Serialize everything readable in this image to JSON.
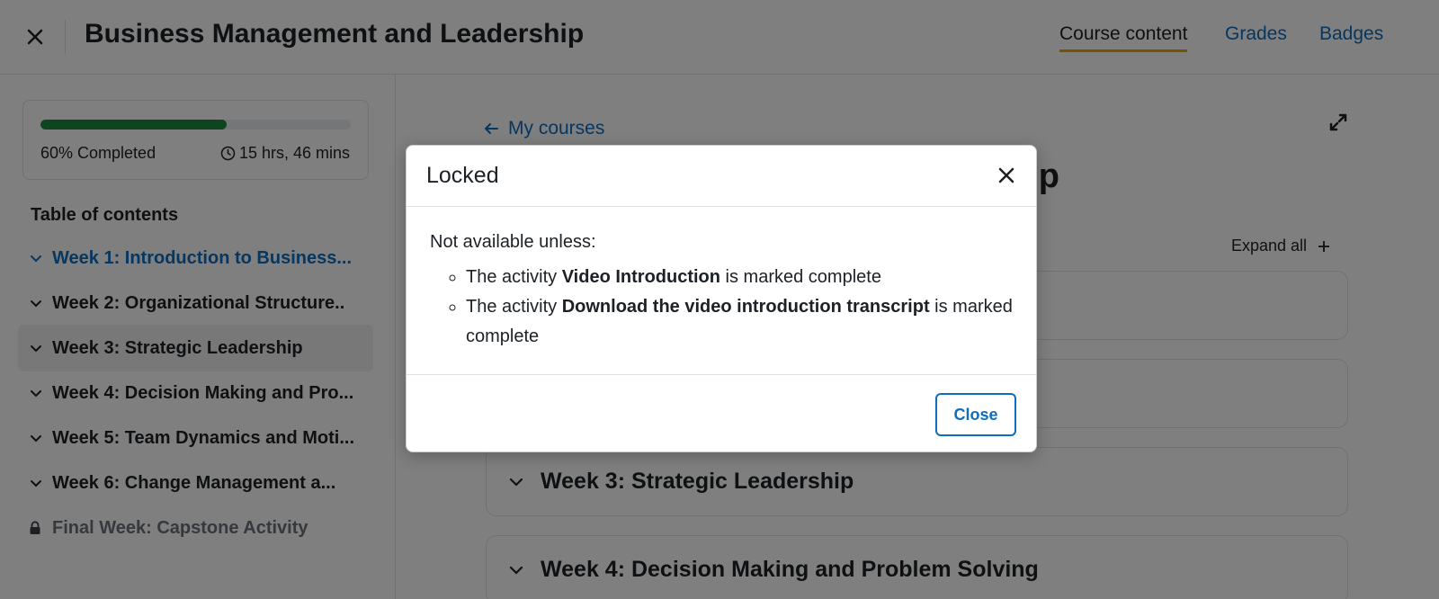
{
  "header": {
    "title": "Business Management and Leadership",
    "nav": [
      {
        "label": "Course content",
        "active": true
      },
      {
        "label": "Grades",
        "active": false
      },
      {
        "label": "Badges",
        "active": false
      }
    ]
  },
  "sidebar": {
    "progress": {
      "fraction": 0.6,
      "label": "60% Completed",
      "time": "15 hrs, 46 mins"
    },
    "toc_title": "Table of contents",
    "items": [
      {
        "label": "Week 1: Introduction to Business..."
      },
      {
        "label": "Week 2: Organizational Structure.."
      },
      {
        "label": "Week 3: Strategic Leadership"
      },
      {
        "label": "Week 4: Decision Making and Pro..."
      },
      {
        "label": "Week 5: Team Dynamics and Moti..."
      },
      {
        "label": "Week 6: Change Management a..."
      },
      {
        "label": "Final Week: Capstone Activity"
      }
    ]
  },
  "main": {
    "back_label": "My courses",
    "heading_visible": "hip",
    "expand_all": "Expand all",
    "sections": [
      {
        "label": ""
      },
      {
        "label": ""
      },
      {
        "label": "Week 3: Strategic Leadership"
      },
      {
        "label": "Week 4: Decision Making and Problem Solving"
      }
    ]
  },
  "modal": {
    "title": "Locked",
    "intro": "Not available unless:",
    "conditions": [
      {
        "prefix": "The activity ",
        "activity": "Video Introduction",
        "suffix": " is marked complete"
      },
      {
        "prefix": "The activity ",
        "activity": "Download the video introduction transcript",
        "suffix": " is marked complete"
      }
    ],
    "close_label": "Close"
  },
  "colors": {
    "accent": "#0f6cbf",
    "progress": "#1f8b3d",
    "tab_underline": "#f0a500"
  }
}
